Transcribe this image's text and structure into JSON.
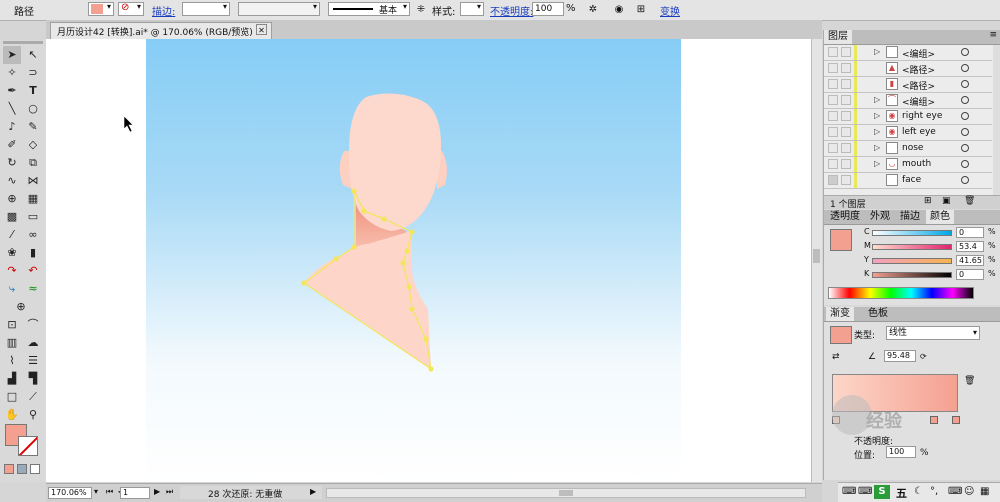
{
  "control_bar": {
    "path_label": "路径",
    "stroke_label": "描边:",
    "style_name": "基本",
    "style_label": "样式:",
    "opacity_label": "不透明度:",
    "opacity_value": "100",
    "opacity_unit": "%",
    "transform_label": "变换"
  },
  "document_tab": {
    "title": "月历设计42 [转换].ai* @ 170.06% (RGB/预览)",
    "close": "✕"
  },
  "status_bar": {
    "zoom": "170.06%",
    "artboard": "1",
    "undo_status": "28 次还原: 无重做"
  },
  "layers_panel": {
    "title": "图层",
    "rows": [
      {
        "name": "<编组>",
        "arrow": "▷"
      },
      {
        "name": "<路径>",
        "arrow": ""
      },
      {
        "name": "<路径>",
        "arrow": ""
      },
      {
        "name": "<编组>",
        "arrow": "▷"
      },
      {
        "name": "right eye",
        "arrow": "▷"
      },
      {
        "name": "left eye",
        "arrow": "▷"
      },
      {
        "name": "nose",
        "arrow": "▷"
      },
      {
        "name": "mouth",
        "arrow": "▷"
      },
      {
        "name": "face",
        "arrow": ""
      }
    ],
    "footer": "1 个图层"
  },
  "color_panel": {
    "tabs": [
      "透明度",
      "外观",
      "描边",
      "颜色"
    ],
    "channels": [
      {
        "label": "C",
        "value": "0",
        "unit": "%"
      },
      {
        "label": "M",
        "value": "53.4",
        "unit": "%"
      },
      {
        "label": "Y",
        "value": "41.65",
        "unit": "%"
      },
      {
        "label": "K",
        "value": "0",
        "unit": "%"
      }
    ]
  },
  "gradient_panel": {
    "tabs": [
      "渐变",
      "色板"
    ],
    "type_label": "类型:",
    "type_value": "线性",
    "angle_value": "95.48",
    "opacity_label": "不透明度:",
    "location_label": "位置:",
    "location_value": "100",
    "location_unit": "%"
  },
  "ime_bar": {
    "label": "五"
  },
  "watermark": {
    "text": "经验"
  },
  "colors": {
    "sky_top": "#86cdf6",
    "sky_bottom": "#ffffff",
    "skin": "#fdd6c9",
    "neck_shadow": "#f59c86",
    "selection": "#f2e65a",
    "fill_swatch": "#f4a090"
  }
}
